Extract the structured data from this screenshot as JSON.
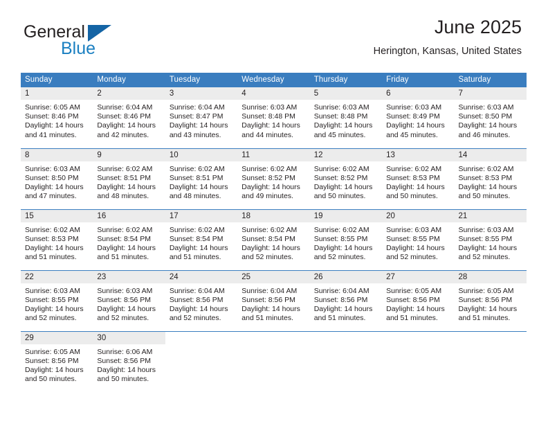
{
  "brand": {
    "name_part1": "General",
    "name_part2": "Blue",
    "accent_color": "#1a7fc1",
    "triangle_color": "#1464a5",
    "triangle_icon": "triangle-icon"
  },
  "header": {
    "title": "June 2025",
    "subtitle": "Herington, Kansas, United States"
  },
  "theme": {
    "header_blue": "#3a7dbf",
    "daynum_band": "#ececec",
    "text": "#231f20"
  },
  "weekday_headers": [
    "Sunday",
    "Monday",
    "Tuesday",
    "Wednesday",
    "Thursday",
    "Friday",
    "Saturday"
  ],
  "weeks": [
    [
      {
        "day": "1",
        "sunrise": "Sunrise: 6:05 AM",
        "sunset": "Sunset: 8:46 PM",
        "daylight_line1": "Daylight: 14 hours",
        "daylight_line2": "and 41 minutes."
      },
      {
        "day": "2",
        "sunrise": "Sunrise: 6:04 AM",
        "sunset": "Sunset: 8:46 PM",
        "daylight_line1": "Daylight: 14 hours",
        "daylight_line2": "and 42 minutes."
      },
      {
        "day": "3",
        "sunrise": "Sunrise: 6:04 AM",
        "sunset": "Sunset: 8:47 PM",
        "daylight_line1": "Daylight: 14 hours",
        "daylight_line2": "and 43 minutes."
      },
      {
        "day": "4",
        "sunrise": "Sunrise: 6:03 AM",
        "sunset": "Sunset: 8:48 PM",
        "daylight_line1": "Daylight: 14 hours",
        "daylight_line2": "and 44 minutes."
      },
      {
        "day": "5",
        "sunrise": "Sunrise: 6:03 AM",
        "sunset": "Sunset: 8:48 PM",
        "daylight_line1": "Daylight: 14 hours",
        "daylight_line2": "and 45 minutes."
      },
      {
        "day": "6",
        "sunrise": "Sunrise: 6:03 AM",
        "sunset": "Sunset: 8:49 PM",
        "daylight_line1": "Daylight: 14 hours",
        "daylight_line2": "and 45 minutes."
      },
      {
        "day": "7",
        "sunrise": "Sunrise: 6:03 AM",
        "sunset": "Sunset: 8:50 PM",
        "daylight_line1": "Daylight: 14 hours",
        "daylight_line2": "and 46 minutes."
      }
    ],
    [
      {
        "day": "8",
        "sunrise": "Sunrise: 6:03 AM",
        "sunset": "Sunset: 8:50 PM",
        "daylight_line1": "Daylight: 14 hours",
        "daylight_line2": "and 47 minutes."
      },
      {
        "day": "9",
        "sunrise": "Sunrise: 6:02 AM",
        "sunset": "Sunset: 8:51 PM",
        "daylight_line1": "Daylight: 14 hours",
        "daylight_line2": "and 48 minutes."
      },
      {
        "day": "10",
        "sunrise": "Sunrise: 6:02 AM",
        "sunset": "Sunset: 8:51 PM",
        "daylight_line1": "Daylight: 14 hours",
        "daylight_line2": "and 48 minutes."
      },
      {
        "day": "11",
        "sunrise": "Sunrise: 6:02 AM",
        "sunset": "Sunset: 8:52 PM",
        "daylight_line1": "Daylight: 14 hours",
        "daylight_line2": "and 49 minutes."
      },
      {
        "day": "12",
        "sunrise": "Sunrise: 6:02 AM",
        "sunset": "Sunset: 8:52 PM",
        "daylight_line1": "Daylight: 14 hours",
        "daylight_line2": "and 50 minutes."
      },
      {
        "day": "13",
        "sunrise": "Sunrise: 6:02 AM",
        "sunset": "Sunset: 8:53 PM",
        "daylight_line1": "Daylight: 14 hours",
        "daylight_line2": "and 50 minutes."
      },
      {
        "day": "14",
        "sunrise": "Sunrise: 6:02 AM",
        "sunset": "Sunset: 8:53 PM",
        "daylight_line1": "Daylight: 14 hours",
        "daylight_line2": "and 50 minutes."
      }
    ],
    [
      {
        "day": "15",
        "sunrise": "Sunrise: 6:02 AM",
        "sunset": "Sunset: 8:53 PM",
        "daylight_line1": "Daylight: 14 hours",
        "daylight_line2": "and 51 minutes."
      },
      {
        "day": "16",
        "sunrise": "Sunrise: 6:02 AM",
        "sunset": "Sunset: 8:54 PM",
        "daylight_line1": "Daylight: 14 hours",
        "daylight_line2": "and 51 minutes."
      },
      {
        "day": "17",
        "sunrise": "Sunrise: 6:02 AM",
        "sunset": "Sunset: 8:54 PM",
        "daylight_line1": "Daylight: 14 hours",
        "daylight_line2": "and 51 minutes."
      },
      {
        "day": "18",
        "sunrise": "Sunrise: 6:02 AM",
        "sunset": "Sunset: 8:54 PM",
        "daylight_line1": "Daylight: 14 hours",
        "daylight_line2": "and 52 minutes."
      },
      {
        "day": "19",
        "sunrise": "Sunrise: 6:02 AM",
        "sunset": "Sunset: 8:55 PM",
        "daylight_line1": "Daylight: 14 hours",
        "daylight_line2": "and 52 minutes."
      },
      {
        "day": "20",
        "sunrise": "Sunrise: 6:03 AM",
        "sunset": "Sunset: 8:55 PM",
        "daylight_line1": "Daylight: 14 hours",
        "daylight_line2": "and 52 minutes."
      },
      {
        "day": "21",
        "sunrise": "Sunrise: 6:03 AM",
        "sunset": "Sunset: 8:55 PM",
        "daylight_line1": "Daylight: 14 hours",
        "daylight_line2": "and 52 minutes."
      }
    ],
    [
      {
        "day": "22",
        "sunrise": "Sunrise: 6:03 AM",
        "sunset": "Sunset: 8:55 PM",
        "daylight_line1": "Daylight: 14 hours",
        "daylight_line2": "and 52 minutes."
      },
      {
        "day": "23",
        "sunrise": "Sunrise: 6:03 AM",
        "sunset": "Sunset: 8:56 PM",
        "daylight_line1": "Daylight: 14 hours",
        "daylight_line2": "and 52 minutes."
      },
      {
        "day": "24",
        "sunrise": "Sunrise: 6:04 AM",
        "sunset": "Sunset: 8:56 PM",
        "daylight_line1": "Daylight: 14 hours",
        "daylight_line2": "and 52 minutes."
      },
      {
        "day": "25",
        "sunrise": "Sunrise: 6:04 AM",
        "sunset": "Sunset: 8:56 PM",
        "daylight_line1": "Daylight: 14 hours",
        "daylight_line2": "and 51 minutes."
      },
      {
        "day": "26",
        "sunrise": "Sunrise: 6:04 AM",
        "sunset": "Sunset: 8:56 PM",
        "daylight_line1": "Daylight: 14 hours",
        "daylight_line2": "and 51 minutes."
      },
      {
        "day": "27",
        "sunrise": "Sunrise: 6:05 AM",
        "sunset": "Sunset: 8:56 PM",
        "daylight_line1": "Daylight: 14 hours",
        "daylight_line2": "and 51 minutes."
      },
      {
        "day": "28",
        "sunrise": "Sunrise: 6:05 AM",
        "sunset": "Sunset: 8:56 PM",
        "daylight_line1": "Daylight: 14 hours",
        "daylight_line2": "and 51 minutes."
      }
    ],
    [
      {
        "day": "29",
        "sunrise": "Sunrise: 6:05 AM",
        "sunset": "Sunset: 8:56 PM",
        "daylight_line1": "Daylight: 14 hours",
        "daylight_line2": "and 50 minutes."
      },
      {
        "day": "30",
        "sunrise": "Sunrise: 6:06 AM",
        "sunset": "Sunset: 8:56 PM",
        "daylight_line1": "Daylight: 14 hours",
        "daylight_line2": "and 50 minutes."
      },
      null,
      null,
      null,
      null,
      null
    ]
  ]
}
